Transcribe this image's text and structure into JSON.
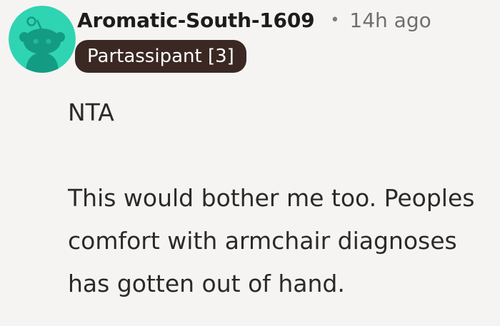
{
  "comment": {
    "author": "Aromatic-South-1609",
    "separator": "•",
    "time": "14h ago",
    "flair": "Partassipant [3]",
    "paragraphs": [
      "NTA",
      "This would bother me too. Peoples comfort with armchair diagnoses has gotten out of hand."
    ]
  },
  "avatar": {
    "icon": "snoo-avatar-icon",
    "background_color": "#2fd4b3",
    "figure_color": "#139c83"
  },
  "colors": {
    "page_background": "#f5f4f2",
    "flair_background": "#3b2822",
    "flair_text": "#ffffff",
    "timestamp": "#6f6f6f"
  }
}
